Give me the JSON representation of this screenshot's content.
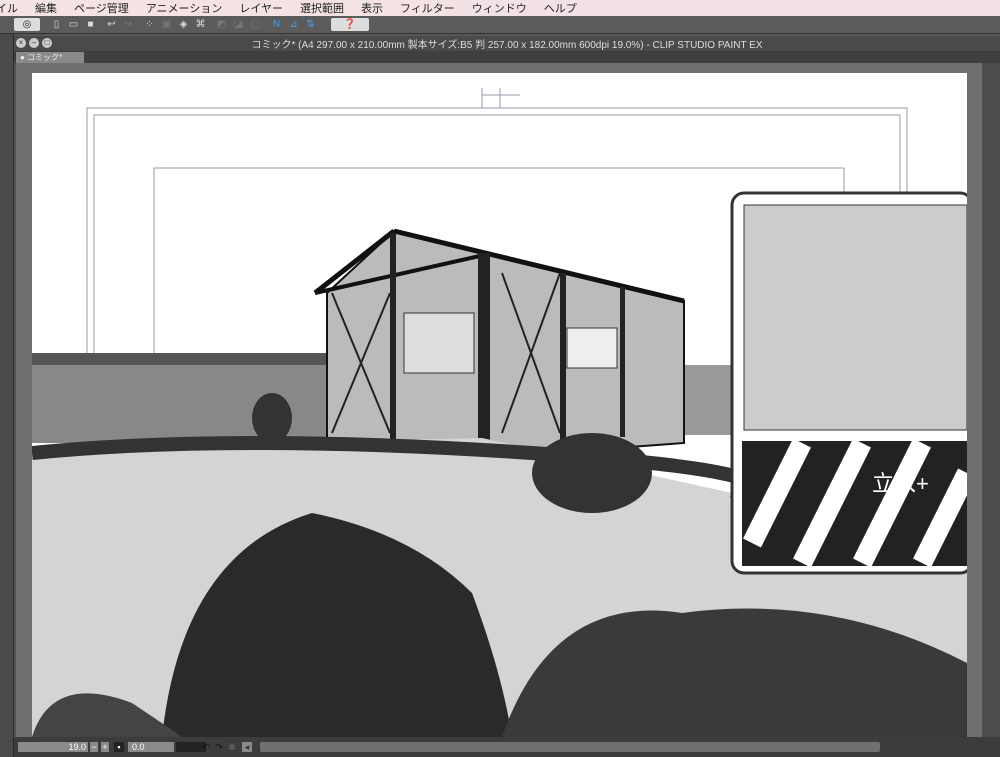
{
  "menu": [
    "イル",
    "編集",
    "ページ管理",
    "アニメーション",
    "レイヤー",
    "選択範囲",
    "表示",
    "フィルター",
    "ウィンドウ",
    "ヘルプ"
  ],
  "window": {
    "title": "コミック* (A4 297.00 x 210.00mm 製本サイズ:B5 判 257.00 x 182.00mm 600dpi 19.0%)  - CLIP STUDIO PAINT EX",
    "tab": "● コミック*"
  },
  "status": {
    "zoom": "19.0",
    "angle": "0.0"
  },
  "canvas": {
    "sign_text": "立入+"
  }
}
